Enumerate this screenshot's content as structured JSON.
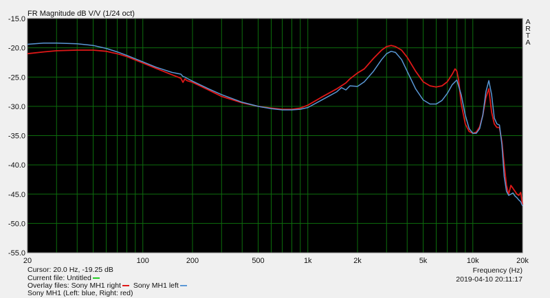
{
  "header": {
    "title": "FR Magnitude dB V/V (1/24 oct)",
    "brand_letters": [
      "A",
      "R",
      "T",
      "A"
    ]
  },
  "footer": {
    "cursor": "Cursor: 20.0 Hz, -19.25 dB",
    "current_file": "Current file: Untitled",
    "overlay_label": "Overlay files:",
    "overlay_right": "Sony MH1 right",
    "overlay_left": "Sony MH1 left",
    "description": "Sony MH1 (Left: blue, Right: red)",
    "x_axis_title": "Frequency (Hz)",
    "timestamp": "2019-04-10  20:11:17"
  },
  "colors": {
    "background": "#000000",
    "grid": "#0d6e0d",
    "current": "#22cc22",
    "right": "#e01818",
    "left": "#5a98d6"
  },
  "chart_data": {
    "type": "line",
    "title": "FR Magnitude dB V/V (1/24 oct)",
    "xlabel": "Frequency (Hz)",
    "ylabel": "",
    "x_scale": "log",
    "xlim": [
      20,
      20000
    ],
    "ylim": [
      -55,
      -15
    ],
    "grid": true,
    "x_ticks": [
      20,
      100,
      200,
      500,
      1000,
      2000,
      5000,
      10000,
      20000
    ],
    "x_tick_labels": [
      "20",
      "100",
      "200",
      "500",
      "1k",
      "2k",
      "5k",
      "10k",
      "20k"
    ],
    "y_ticks": [
      -15,
      -20,
      -25,
      -30,
      -35,
      -40,
      -45,
      -50,
      -55
    ],
    "y_tick_labels": [
      "-15.0",
      "-20.0",
      "-25.0",
      "-30.0",
      "-35.0",
      "-40.0",
      "-45.0",
      "-50.0",
      "-55.0"
    ],
    "series": [
      {
        "name": "Sony MH1 right",
        "color": "#e01818",
        "x": [
          20,
          25,
          30,
          40,
          50,
          60,
          70,
          80,
          100,
          120,
          150,
          170,
          175,
          180,
          185,
          200,
          250,
          300,
          400,
          500,
          600,
          700,
          800,
          900,
          1000,
          1200,
          1500,
          1700,
          1800,
          2000,
          2200,
          2500,
          2800,
          3000,
          3200,
          3400,
          3700,
          4000,
          4500,
          5000,
          5500,
          6000,
          6500,
          7000,
          7500,
          7800,
          8000,
          8200,
          8500,
          9000,
          9500,
          10000,
          10500,
          11000,
          11500,
          12000,
          12500,
          13000,
          13500,
          14000,
          14500,
          15000,
          15500,
          16000,
          16500,
          17000,
          17500,
          18000,
          18500,
          19000,
          19500,
          20000
        ],
        "values": [
          -21.0,
          -20.7,
          -20.5,
          -20.4,
          -20.4,
          -20.6,
          -21.0,
          -21.5,
          -22.6,
          -23.5,
          -24.6,
          -25.2,
          -25.9,
          -25.3,
          -25.6,
          -25.9,
          -27.2,
          -28.3,
          -29.4,
          -30.0,
          -30.3,
          -30.5,
          -30.5,
          -30.3,
          -29.8,
          -28.5,
          -27.0,
          -26.0,
          -25.3,
          -24.3,
          -23.6,
          -21.8,
          -20.4,
          -19.8,
          -19.6,
          -19.8,
          -20.4,
          -21.6,
          -24.0,
          -25.8,
          -26.5,
          -26.7,
          -26.5,
          -25.8,
          -24.5,
          -23.6,
          -24.0,
          -25.5,
          -29.5,
          -33.0,
          -34.3,
          -34.6,
          -34.4,
          -33.5,
          -31.5,
          -28.5,
          -27.0,
          -31.0,
          -33.0,
          -33.6,
          -33.6,
          -36.0,
          -40.0,
          -43.5,
          -45.0,
          -43.5,
          -44.0,
          -44.5,
          -45.0,
          -45.2,
          -44.7,
          -46.8
        ]
      },
      {
        "name": "Sony MH1 left",
        "color": "#5a98d6",
        "x": [
          20,
          25,
          30,
          40,
          50,
          60,
          70,
          80,
          100,
          120,
          150,
          170,
          175,
          180,
          185,
          200,
          250,
          300,
          400,
          500,
          600,
          700,
          800,
          900,
          1000,
          1200,
          1500,
          1600,
          1700,
          1800,
          2000,
          2200,
          2500,
          2800,
          3000,
          3200,
          3400,
          3700,
          4000,
          4500,
          5000,
          5500,
          6000,
          6500,
          7000,
          7500,
          8000,
          8500,
          9000,
          9500,
          10000,
          10500,
          11000,
          11500,
          12000,
          12500,
          13000,
          13500,
          14000,
          14500,
          15000,
          15500,
          16000,
          16500,
          17000,
          17500,
          18000,
          18500,
          19000,
          19500,
          20000
        ],
        "values": [
          -19.4,
          -19.2,
          -19.2,
          -19.3,
          -19.6,
          -20.1,
          -20.7,
          -21.3,
          -22.4,
          -23.3,
          -24.2,
          -24.5,
          -24.9,
          -25.0,
          -25.2,
          -25.7,
          -27.0,
          -28.0,
          -29.3,
          -30.0,
          -30.4,
          -30.6,
          -30.6,
          -30.5,
          -30.2,
          -29.0,
          -27.5,
          -26.8,
          -27.2,
          -26.5,
          -26.6,
          -25.8,
          -24.0,
          -22.0,
          -21.0,
          -20.6,
          -20.8,
          -22.0,
          -24.0,
          -27.0,
          -28.9,
          -29.6,
          -29.6,
          -29.0,
          -27.8,
          -26.3,
          -25.5,
          -28.0,
          -31.5,
          -33.8,
          -34.6,
          -34.6,
          -33.8,
          -31.5,
          -27.5,
          -25.6,
          -28.0,
          -32.0,
          -33.0,
          -33.2,
          -36.5,
          -42.0,
          -44.5,
          -45.2,
          -45.0,
          -44.8,
          -45.3,
          -45.6,
          -46.0,
          -46.3,
          -47.0
        ]
      }
    ]
  }
}
